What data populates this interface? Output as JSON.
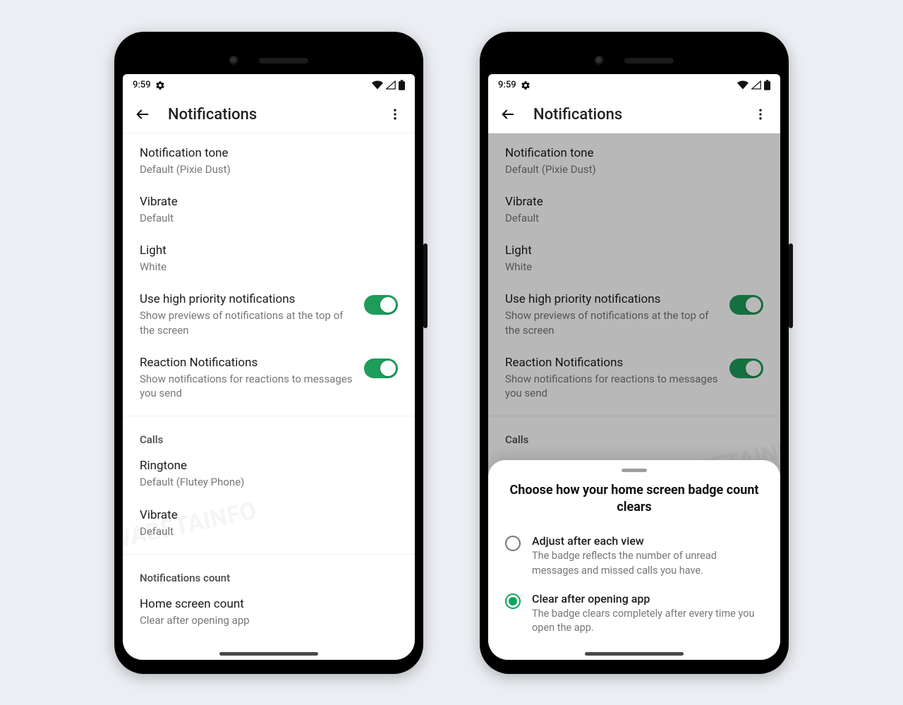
{
  "status": {
    "time": "9:59"
  },
  "app_bar": {
    "title": "Notifications"
  },
  "settings": {
    "notification_tone": {
      "title": "Notification tone",
      "value": "Default (Pixie Dust)"
    },
    "vibrate_msg": {
      "title": "Vibrate",
      "value": "Default"
    },
    "light": {
      "title": "Light",
      "value": "White"
    },
    "high_priority": {
      "title": "Use high priority notifications",
      "subtitle": "Show previews of notifications at the top of the screen",
      "on": true
    },
    "reaction": {
      "title": "Reaction Notifications",
      "subtitle": "Show notifications for reactions to messages you send",
      "on": true
    },
    "section_calls": "Calls",
    "ringtone": {
      "title": "Ringtone",
      "value": "Default (Flutey Phone)"
    },
    "vibrate_call": {
      "title": "Vibrate",
      "value": "Default"
    },
    "section_count": "Notifications count",
    "home_count": {
      "title": "Home screen count",
      "value": "Clear after opening app"
    }
  },
  "sheet": {
    "title": "Choose how your home screen badge count clears",
    "options": [
      {
        "title": "Adjust after each view",
        "subtitle": "The badge reflects the number of unread messages and missed calls you have.",
        "selected": false
      },
      {
        "title": "Clear after opening app",
        "subtitle": "The badge clears completely after every time you open the app.",
        "selected": true
      }
    ]
  },
  "watermark": "WABETAINFO"
}
